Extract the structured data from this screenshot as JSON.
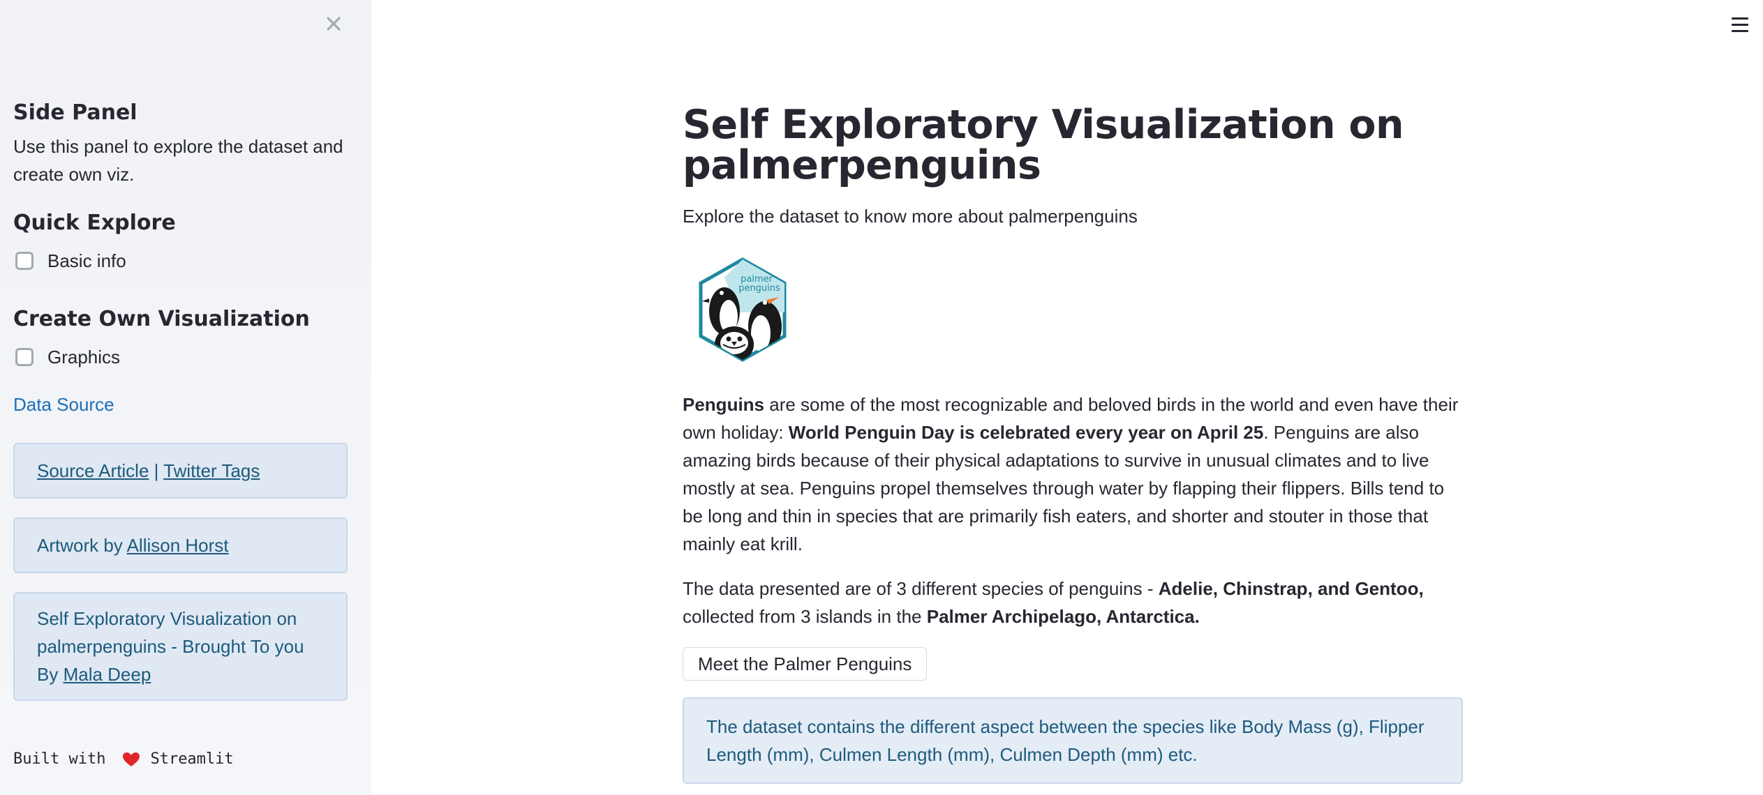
{
  "sidebar": {
    "heading": "Side Panel",
    "description": "Use this panel to explore the dataset and create own viz.",
    "quick_explore": {
      "heading": "Quick Explore",
      "checkbox_label": "Basic info",
      "checked": false
    },
    "create_viz": {
      "heading": "Create Own Visualization",
      "checkbox_label": "Graphics",
      "checked": false
    },
    "data_source_label": "Data Source",
    "info_box_1": {
      "link_1": "Source Article",
      "separator": " | ",
      "link_2": "Twitter Tags"
    },
    "info_box_2": {
      "prefix": "Artwork by ",
      "link": "Allison Horst"
    },
    "info_box_3": {
      "prefix": "Self Exploratory Visualization on palmerpenguins - Brought To you By ",
      "link": "Mala Deep"
    },
    "footer": {
      "prefix": "Built with",
      "suffix": "Streamlit",
      "heart_icon": "heart-icon"
    }
  },
  "main": {
    "title": "Self Exploratory Visualization on palmerpenguins",
    "subtitle": "Explore the dataset to know more about palmerpenguins",
    "logo": {
      "icon": "palmer-penguins-logo",
      "text_top": "palmer",
      "text_bottom": "penguins"
    },
    "paragraph_1": {
      "b1": "Penguins",
      "t1": " are some of the most recognizable and beloved birds in the world and even have their own holiday: ",
      "b2": "World Penguin Day is celebrated every year on April 25",
      "t2": ". Penguins are also amazing birds because of their physical adaptations to survive in unusual climates and to live mostly at sea. Penguins propel themselves through water by flapping their flippers. Bills tend to be long and thin in species that are primarily fish eaters, and shorter and stouter in those that mainly eat krill."
    },
    "paragraph_2": {
      "t1": "The data presented are of 3 different species of penguins - ",
      "b1": "Adelie, Chinstrap, and Gentoo,",
      "t2": " collected from 3 islands in the ",
      "b2": "Palmer Archipelago, Antarctica."
    },
    "button_label": "Meet the Palmer Penguins",
    "info_text": "The dataset contains the different aspect between the species like Body Mass (g), Flipper Length (mm), Culmen Length (mm), Culmen Depth (mm) etc."
  },
  "icons": {
    "close": "close-icon",
    "menu": "hamburger-menu-icon"
  },
  "colors": {
    "sidebar_bg": "#f0f2f6",
    "link": "#1c6eb8",
    "info_bg": "#e4ecf6",
    "info_text": "#1e5a7c",
    "logo_teal": "#1f8a9e",
    "heart": "#e0252b"
  }
}
